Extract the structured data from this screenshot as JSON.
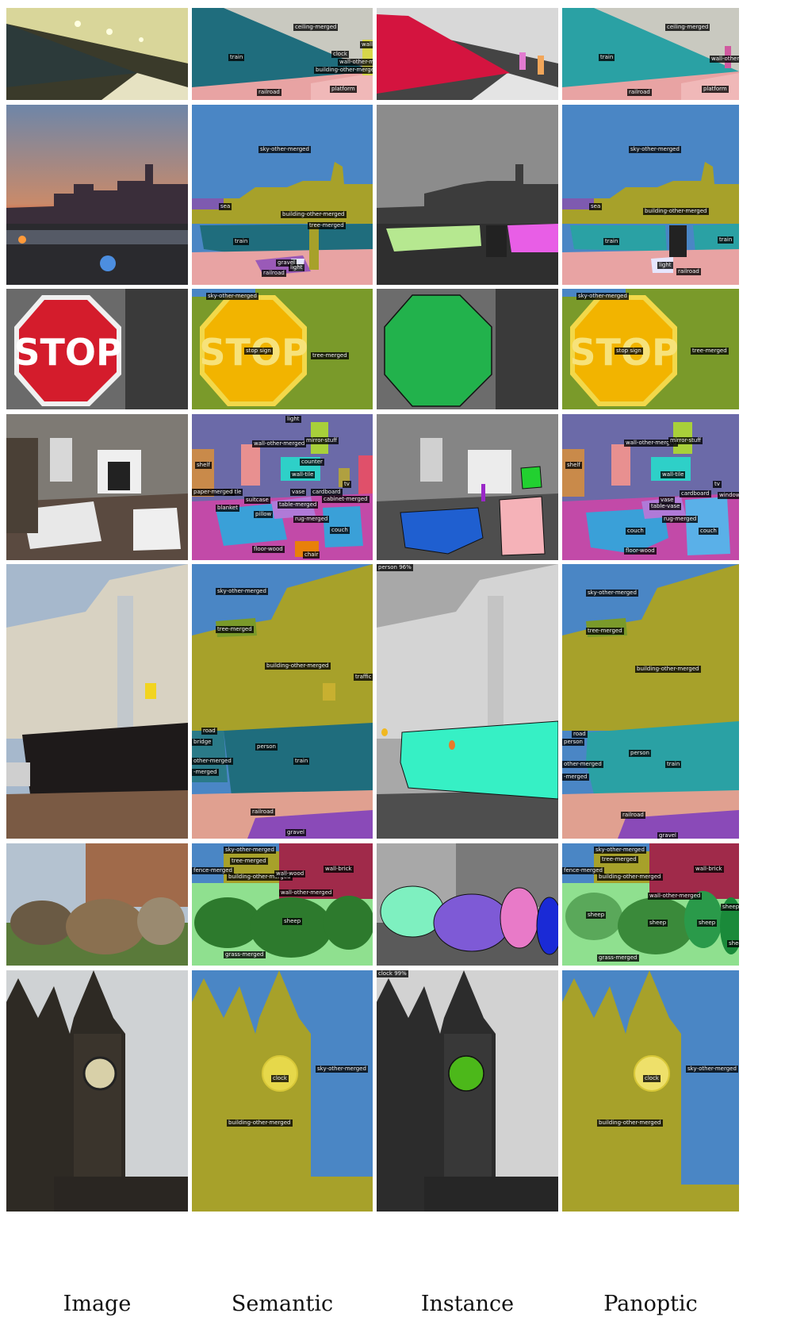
{
  "columns": [
    "Image",
    "Semantic",
    "Instance",
    "Panoptic"
  ],
  "colors": {
    "train_sem": "#1f6d7d",
    "train_inst": "#d4143f",
    "railroad": "#e8a3a3",
    "platform": "#f0b8b8",
    "ceiling": "#c9c9c0",
    "sky": "#4a86c5",
    "building": "#a7a12a",
    "tree": "#7a9a2a",
    "stop_sign": "#f2b400",
    "stop_inst": "#22b24c",
    "wall": "#6b6aa8",
    "couch": "#3aa0d8",
    "floor": "#c24aa8",
    "mint": "#36f0c5",
    "sheep": "#2d7a2d",
    "grass": "#8fe08f",
    "clock": "#e6d84a",
    "clock_inst": "#4cb81a"
  },
  "rows": [
    {
      "semantic_labels": [
        "ceiling-merged",
        "wall-ti",
        "clock",
        "wall-other-merged",
        "train",
        "building-other-merged",
        "railroad",
        "platform"
      ],
      "panoptic_labels": [
        "ceiling-merged",
        "train",
        "wall-other-merged",
        "railroad",
        "platform"
      ]
    },
    {
      "semantic_labels": [
        "sky-other-merged",
        "sea",
        "building-other-merged",
        "tree-merged",
        "train",
        "gravel",
        "light",
        "railroad"
      ],
      "panoptic_labels": [
        "sky-other-merged",
        "sea",
        "building-other-merged",
        "train",
        "train",
        "light",
        "railroad"
      ]
    },
    {
      "semantic_labels": [
        "sky-other-merged",
        "stop sign",
        "tree-merged"
      ],
      "panoptic_labels": [
        "sky-other-merged",
        "stop sign",
        "tree-merged"
      ]
    },
    {
      "semantic_labels": [
        "light",
        "wall-other-merged",
        "mirror-stuff",
        "counter",
        "shelf",
        "wall-tile",
        "tv",
        "bottle",
        "paper-merged",
        "vase",
        "cardboard",
        "cabinet-merged",
        "suitcase",
        "table-merged",
        "blanket",
        "pillow",
        "rug-merged",
        "couch",
        "floor-wood",
        "chair"
      ],
      "panoptic_labels": [
        "wall-other-merged",
        "mirror-stuff",
        "shelf",
        "wall-tile",
        "tv",
        "cardboard",
        "window-",
        "vase",
        "table-vase",
        "rug-merged",
        "couch",
        "couch",
        "floor-wood"
      ]
    },
    {
      "semantic_labels": [
        "sky-other-merged",
        "tree-merged",
        "building-other-merged",
        "traffic",
        "road",
        "bridge",
        "person",
        "other-merged",
        "-merged",
        "train",
        "railroad",
        "gravel"
      ],
      "instance_labels": [
        "person 96%"
      ],
      "panoptic_labels": [
        "sky-other-merged",
        "tree-merged",
        "building-other-merged",
        "road",
        "person",
        "person",
        "other-merged",
        "-merged",
        "train",
        "railroad",
        "gravel"
      ]
    },
    {
      "semantic_labels": [
        "sky-other-merged",
        "tree-merged",
        "fence-merged",
        "building-other-merged",
        "wall-wood",
        "wall-brick",
        "wall-other-merged",
        "sheep",
        "grass-merged"
      ],
      "panoptic_labels": [
        "sky-other-merged",
        "tree-merged",
        "fence-merged",
        "building-other-merged",
        "wall-brick",
        "wall-other-merged",
        "sheep",
        "sheep",
        "sheep",
        "sheep",
        "sheep",
        "grass-merged"
      ]
    },
    {
      "semantic_labels": [
        "clock",
        "sky-other-merged",
        "building-other-merged"
      ],
      "instance_labels": [
        "clock 99%"
      ],
      "panoptic_labels": [
        "clock",
        "sky-other-merged",
        "building-other-merged"
      ]
    }
  ]
}
